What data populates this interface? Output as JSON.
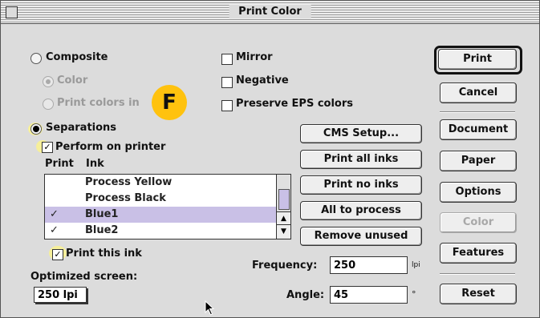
{
  "window": {
    "title": "Print Color"
  },
  "radios": {
    "composite": "Composite",
    "color": "Color",
    "print_colors_in": "Print colors in",
    "separations": "Separations"
  },
  "checks": {
    "mirror": "Mirror",
    "negative": "Negative",
    "preserve_eps": "Preserve EPS colors",
    "perform_on_printer": "Perform on printer",
    "print_this_ink": "Print this ink"
  },
  "list": {
    "col_print": "Print",
    "col_ink": "Ink",
    "rows": [
      {
        "tick": "",
        "name": "Process Yellow"
      },
      {
        "tick": "",
        "name": "Process Black"
      },
      {
        "tick": "✓",
        "name": "Blue1"
      },
      {
        "tick": "✓",
        "name": "Blue2"
      }
    ]
  },
  "middle_buttons": {
    "cms_setup": "CMS Setup...",
    "print_all_inks": "Print all inks",
    "print_no_inks": "Print no inks",
    "all_to_process": "All to process",
    "remove_unused": "Remove unused"
  },
  "right_buttons": {
    "print": "Print",
    "cancel": "Cancel",
    "document": "Document",
    "paper": "Paper",
    "options": "Options",
    "color": "Color",
    "features": "Features",
    "reset": "Reset"
  },
  "screen": {
    "label": "Optimized screen:",
    "value": "250 lpi"
  },
  "frequency": {
    "label": "Frequency:",
    "value": "250",
    "unit": "lpi"
  },
  "angle": {
    "label": "Angle:",
    "value": "45",
    "unit": "°"
  },
  "callout": "F",
  "colors": {
    "selection": "#c9c0e6",
    "highlight": "#f6ef9a",
    "callout": "#ffc20e"
  }
}
